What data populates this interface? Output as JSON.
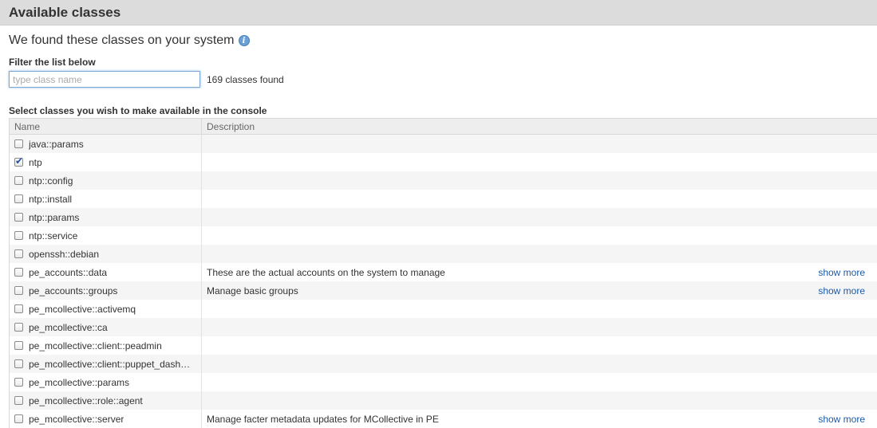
{
  "header": {
    "title": "Available classes"
  },
  "intro": {
    "text": "We found these classes on your system",
    "info_icon": "info-icon"
  },
  "filter": {
    "label": "Filter the list below",
    "placeholder": "type class name",
    "value": "",
    "count_text": "169 classes found"
  },
  "select_label": "Select classes you wish to make available in the console",
  "table": {
    "columns": [
      "Name",
      "Description"
    ],
    "rows": [
      {
        "name": "java::params",
        "checked": false,
        "description": "",
        "link": ""
      },
      {
        "name": "ntp",
        "checked": true,
        "description": "",
        "link": ""
      },
      {
        "name": "ntp::config",
        "checked": false,
        "description": "",
        "link": ""
      },
      {
        "name": "ntp::install",
        "checked": false,
        "description": "",
        "link": ""
      },
      {
        "name": "ntp::params",
        "checked": false,
        "description": "",
        "link": ""
      },
      {
        "name": "ntp::service",
        "checked": false,
        "description": "",
        "link": ""
      },
      {
        "name": "openssh::debian",
        "checked": false,
        "description": "",
        "link": ""
      },
      {
        "name": "pe_accounts::data",
        "checked": false,
        "description": "These are the actual accounts on the system to manage",
        "link": "show more"
      },
      {
        "name": "pe_accounts::groups",
        "checked": false,
        "description": "Manage basic groups",
        "link": "show more"
      },
      {
        "name": "pe_mcollective::activemq",
        "checked": false,
        "description": "",
        "link": ""
      },
      {
        "name": "pe_mcollective::ca",
        "checked": false,
        "description": "",
        "link": ""
      },
      {
        "name": "pe_mcollective::client::peadmin",
        "checked": false,
        "description": "",
        "link": ""
      },
      {
        "name": "pe_mcollective::client::puppet_dash…",
        "checked": false,
        "description": "",
        "link": ""
      },
      {
        "name": "pe_mcollective::params",
        "checked": false,
        "description": "",
        "link": ""
      },
      {
        "name": "pe_mcollective::role::agent",
        "checked": false,
        "description": "",
        "link": ""
      },
      {
        "name": "pe_mcollective::server",
        "checked": false,
        "description": "Manage facter metadata updates for MCollective in PE",
        "link": "show more"
      }
    ]
  }
}
